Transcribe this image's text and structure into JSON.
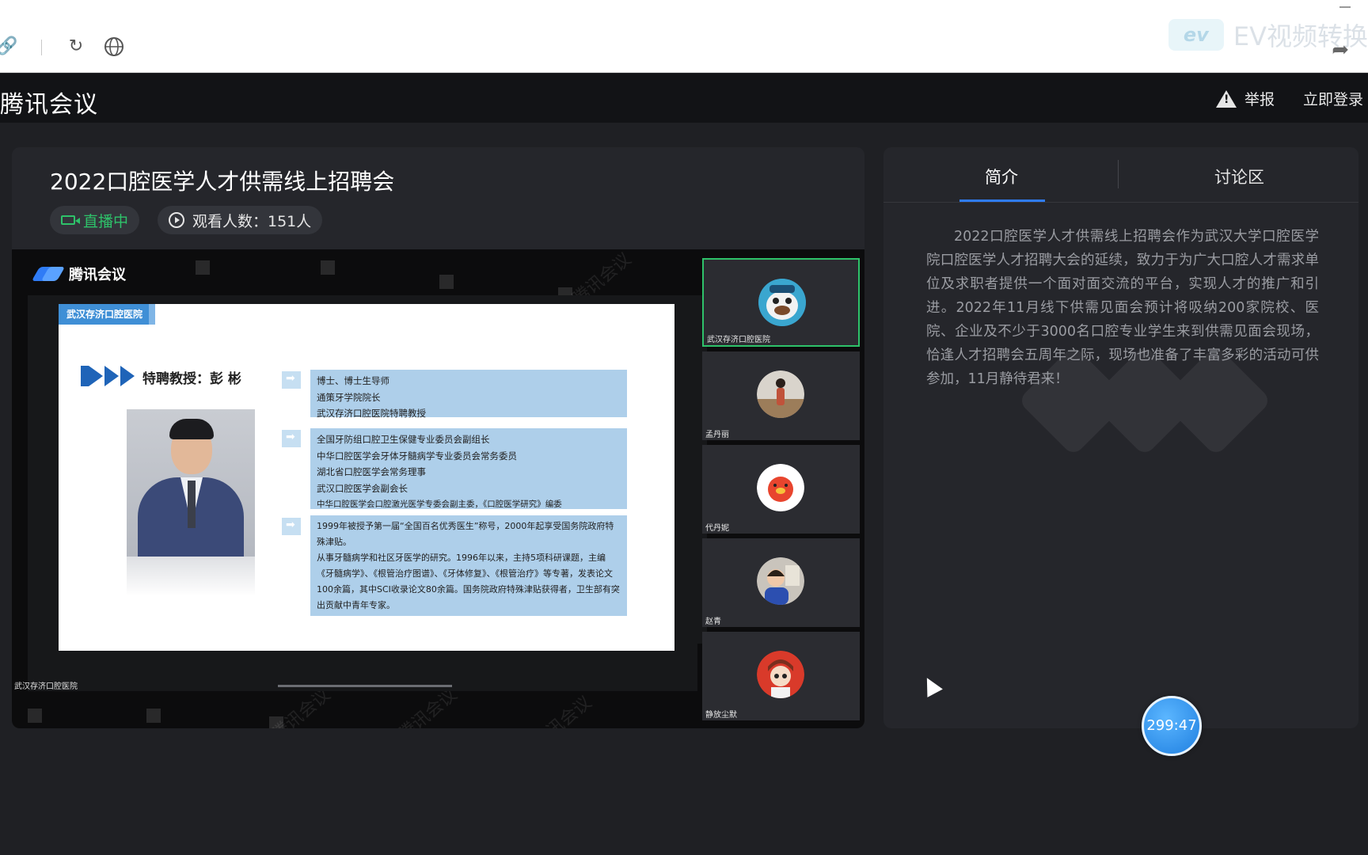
{
  "browser": {
    "watermark_text": "EV视频转换",
    "ev_logo": "ev",
    "icons": [
      "link-icon",
      "refresh-icon",
      "globe-icon",
      "share-icon"
    ]
  },
  "header": {
    "app_title": "腾讯会议",
    "report_label": "举报",
    "login_label": "立即登录"
  },
  "event": {
    "title": "2022口腔医学人才供需线上招聘会",
    "live_label": "直播中",
    "views_label": "观看人数：151人"
  },
  "video": {
    "logo_text": "腾讯会议",
    "watermark": "腾讯会议",
    "caption": "武汉存济口腔医院",
    "slide": {
      "tag": "武汉存济口腔医院",
      "heading": "特聘教授：彭 彬",
      "blocks": [
        [
          "博士、博士生导师",
          "通策牙学院院长",
          "武汉存济口腔医院特聘教授"
        ],
        [
          "全国牙防组口腔卫生保健专业委员会副组长",
          "中华口腔医学会牙体牙髓病学专业委员会常务委员",
          "湖北省口腔医学会常务理事",
          "武汉口腔医学会副会长",
          "中华口腔医学会口腔激光医学专委会副主委，《口腔医学研究》编委"
        ],
        [
          "1999年被授予第一届“全国百名优秀医生”称号，2000年起享受国务院政府特殊津贴。",
          "从事牙髓病学和社区牙医学的研究。1996年以来，主持5项科研课题，主编《牙髓病学》、《根管治疗图谱》、《牙体修复》、《根管治疗》等专著，发表论文100余篇，其中SCI收录论文80余篇。国务院政府特殊津贴获得者，卫生部有突出贡献中青年专家。"
        ]
      ]
    },
    "participants": [
      {
        "name": "武汉存济口腔医院",
        "avatar": "cartoon-avatar-icon"
      },
      {
        "name": "孟丹丽",
        "avatar": "person-avatar-icon"
      },
      {
        "name": "代丹妮",
        "avatar": "pig-avatar-icon"
      },
      {
        "name": "赵青",
        "avatar": "child-avatar-icon"
      },
      {
        "name": "静放尘默",
        "avatar": "anime-avatar-icon"
      }
    ]
  },
  "side": {
    "tab_intro": "简介",
    "tab_discussion": "讨论区",
    "intro_text": "2022口腔医学人才供需线上招聘会作为武汉大学口腔医学院口腔医学人才招聘大会的延续，致力于为广大口腔人才需求单位及求职者提供一个面对面交流的平台，实现人才的推广和引进。2022年11月线下供需见面会预计将吸纳200家院校、医院、企业及不少于3000名口腔专业学生来到供需见面会现场，恰逢人才招聘会五周年之际，现场也准备了丰富多彩的活动可供参加，11月静待君来！"
  },
  "timer": "299:47",
  "colors": {
    "live_green": "#2ec26a",
    "accent_blue": "#2f7cf6",
    "slide_blue": "#aecfea"
  }
}
